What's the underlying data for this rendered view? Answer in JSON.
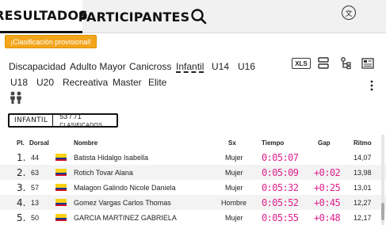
{
  "tabs": [
    {
      "label": "RESULTADOS",
      "active": true
    },
    {
      "label": "PARTICIPANTES",
      "active": false
    }
  ],
  "header": {
    "search_icon": "search-icon",
    "language_icon_glyph": "文"
  },
  "banner": {
    "text": "¡Clasificación provisional!",
    "color": "#f3a51b"
  },
  "categories": {
    "row1": [
      "Discapacidad",
      "Adulto Mayor",
      "Canicross",
      "Infantil",
      "U14",
      "U16"
    ],
    "row2": [
      "U18",
      "U20",
      "Recreativa",
      "Master",
      "Elite"
    ],
    "active": "Infantil"
  },
  "tools": {
    "xls_label": "XLS",
    "icons": [
      "xls-icon",
      "stacked-rows-icon",
      "tree-icon",
      "image-icon",
      "more-vertical-icon"
    ]
  },
  "filter": {
    "category": "INFANTIL",
    "count": "53 / 71",
    "count_suffix": "CLASIFICADOS"
  },
  "table": {
    "headers": {
      "pl": "Pl.",
      "dorsal": "Dorsal",
      "nombre": "Nombre",
      "sx": "Sx",
      "tiempo": "Tiempo",
      "gap": "Gap",
      "ritmo": "Ritmo"
    },
    "rows": [
      {
        "pl": "1.",
        "dorsal": "44",
        "nombre": "Batista Hidalgo Isabella",
        "sx": "Mujer",
        "tiempo": "0:05:07",
        "gap": "",
        "ritmo": "14,07"
      },
      {
        "pl": "2.",
        "dorsal": "63",
        "nombre": "Rotich Tovar Alana",
        "sx": "Mujer",
        "tiempo": "0:05:09",
        "gap": "+0:02",
        "ritmo": "13,98"
      },
      {
        "pl": "3.",
        "dorsal": "57",
        "nombre": "Malagon Galindo Nicole Daniela",
        "sx": "Mujer",
        "tiempo": "0:05:32",
        "gap": "+0:25",
        "ritmo": "13,01"
      },
      {
        "pl": "4.",
        "dorsal": "13",
        "nombre": "Gomez Vargas Carlos Thomas",
        "sx": "Hombre",
        "tiempo": "0:05:52",
        "gap": "+0:45",
        "ritmo": "12,27"
      },
      {
        "pl": "5.",
        "dorsal": "50",
        "nombre": "GARCIA MARTINEZ GABRIELA",
        "sx": "Mujer",
        "tiempo": "0:05:55",
        "gap": "+0:48",
        "ritmo": "12,17"
      }
    ]
  },
  "colors": {
    "time": "#e0208c",
    "banner": "#f3a51b"
  }
}
